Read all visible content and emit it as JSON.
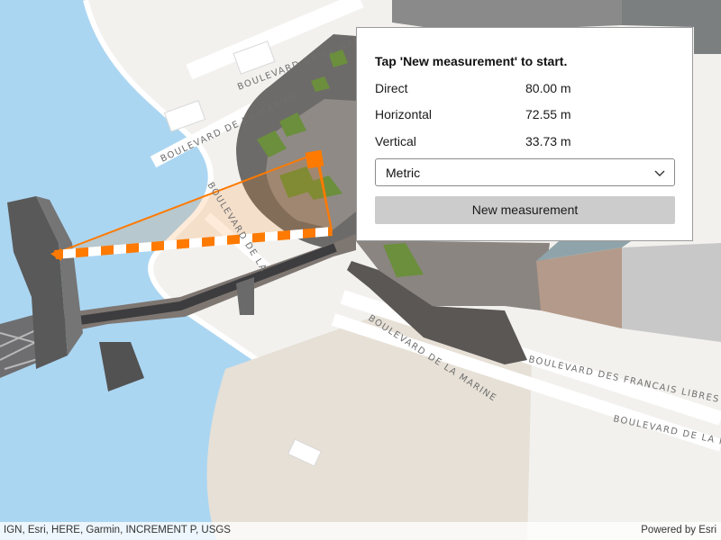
{
  "measurement_panel": {
    "instruction": "Tap 'New measurement' to start.",
    "rows": [
      {
        "label": "Direct",
        "value": "80.00 m"
      },
      {
        "label": "Horizontal",
        "value": "72.55 m"
      },
      {
        "label": "Vertical",
        "value": "33.73 m"
      }
    ],
    "unit_system": {
      "selected": "Metric",
      "icon": "chevron-down-icon"
    },
    "new_measurement_label": "New measurement"
  },
  "map": {
    "street_labels": {
      "marine_top": "BOULEVARD DE LA MARINE",
      "marine_left": "BOULEVARD DE LA MARINE",
      "marine_bottom": "BOULEVARD DE LA MARINE",
      "francais_libres": "BOULEVARD DES FRANCAIS LIBRES",
      "lahen": "BOULEVARD DE LA"
    },
    "colors": {
      "water": "#abd6f2",
      "land": "#f2f1ee",
      "measure_line": "#ff7a00",
      "grass": "#6b8f3c"
    }
  },
  "attribution": {
    "sources": "IGN, Esri, HERE, Garmin, INCREMENT P, USGS",
    "powered_by": "Powered by Esri"
  }
}
